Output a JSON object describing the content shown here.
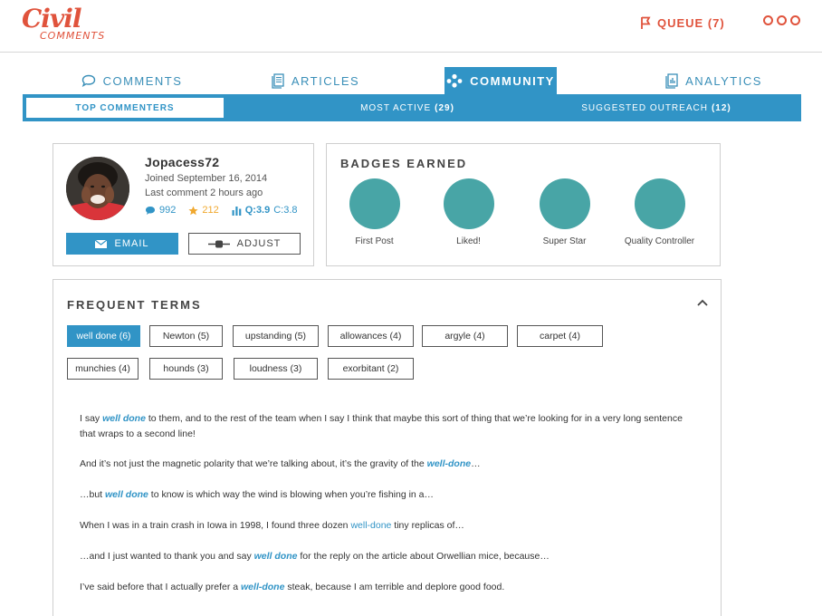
{
  "brand": {
    "logo_main": "Civil",
    "logo_sub": "COMMENTS"
  },
  "header": {
    "queue_label": "QUEUE (7)"
  },
  "tabs": [
    {
      "label": "COMMENTS",
      "icon": "comment-bubble-icon"
    },
    {
      "label": "ARTICLES",
      "icon": "articles-icon"
    },
    {
      "label": "COMMUNITY",
      "icon": "community-icon",
      "active": true
    },
    {
      "label": "ANALYTICS",
      "icon": "analytics-icon"
    }
  ],
  "subtabs": [
    {
      "label": "TOP COMMENTERS",
      "count": "",
      "active": true
    },
    {
      "label": "MOST ACTIVE",
      "count": "(29)"
    },
    {
      "label": "SUGGESTED OUTREACH",
      "count": "(12)"
    }
  ],
  "profile": {
    "username": "Jopacess72",
    "joined": "Joined September 16, 2014",
    "last_comment": "Last comment 2 hours ago",
    "comments_count": "992",
    "stars_count": "212",
    "quality": "Q:3.9",
    "civility": "C:3.8",
    "email_label": "EMAIL",
    "adjust_label": "ADJUST"
  },
  "badges": {
    "title": "BADGES EARNED",
    "items": [
      {
        "label": "First Post"
      },
      {
        "label": "Liked!"
      },
      {
        "label": "Super Star"
      },
      {
        "label": "Quality Controller"
      }
    ],
    "color": "#48a5a6"
  },
  "terms": {
    "title": "FREQUENT TERMS",
    "chips": [
      {
        "label": "well done (6)",
        "active": true
      },
      {
        "label": "Newton (5)"
      },
      {
        "label": "upstanding (5)"
      },
      {
        "label": "allowances (4)"
      },
      {
        "label": "argyle (4)"
      },
      {
        "label": "carpet (4)"
      },
      {
        "label": "munchies (4)"
      },
      {
        "label": "hounds (3)"
      },
      {
        "label": "loudness (3)"
      },
      {
        "label": "exorbitant (2)"
      }
    ],
    "excerpts": [
      {
        "pre": "I say ",
        "term": "well done",
        "post": " to them, and to the rest of  the team when I say I think that maybe this sort of thing that we’re looking for in a very long sentence that wraps to a second line!"
      },
      {
        "pre": "And it’s not just the magnetic polarity that we’re talking about, it’s the gravity of the ",
        "term": "well-done",
        "post": "…"
      },
      {
        "pre": "…but ",
        "term": "well done",
        "post": " to know is which way the wind is blowing when you’re fishing in a…"
      },
      {
        "pre": "When I was in a train crash in Iowa in 1998, I found three dozen ",
        "term": "well-done",
        "post": " tiny replicas of…"
      },
      {
        "pre": "…and I just wanted to thank you and say ",
        "term": "well done",
        "post": " for the reply on the article about Orwellian mice, because…"
      },
      {
        "pre": "I’ve said before that I actually prefer a ",
        "term": "well-done",
        "post": " steak, because I am terrible and deplore good food."
      }
    ]
  },
  "colors": {
    "brand": "#e0533c",
    "accent": "#3194c6",
    "star": "#f0a82e",
    "badge": "#48a5a6"
  }
}
